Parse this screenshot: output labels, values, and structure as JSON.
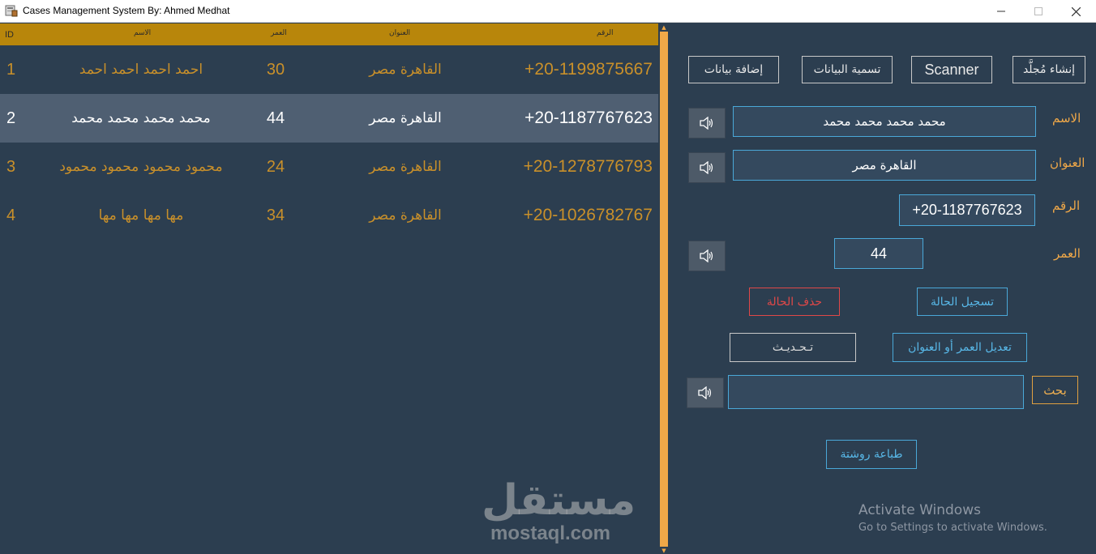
{
  "window": {
    "title": "Cases Management System By: Ahmed Medhat"
  },
  "table": {
    "columns": [
      "ID",
      "الاسم",
      "العمر",
      "العنوان",
      "الرقم"
    ],
    "rows": [
      {
        "id": "1",
        "name": "احمد احمد احمد احمد",
        "age": "30",
        "address": "القاهرة مصر",
        "phone": "+20-1199875667"
      },
      {
        "id": "2",
        "name": "محمد محمد محمد محمد",
        "age": "44",
        "address": "القاهرة مصر",
        "phone": "+20-1187767623"
      },
      {
        "id": "3",
        "name": "محمود محمود محمود محمود",
        "age": "24",
        "address": "القاهرة مصر",
        "phone": "+20-1278776793"
      },
      {
        "id": "4",
        "name": "مها مها مها مها",
        "age": "34",
        "address": "القاهرة مصر",
        "phone": "+20-1026782767"
      }
    ],
    "selected_row": 2
  },
  "toolbar": {
    "create_folder": "إنشاء مُجلَّد",
    "scanner": "Scanner",
    "name_data": "تسمية البيانات",
    "add_data": "إضافة بيانات"
  },
  "form": {
    "name_label": "الاسم",
    "name_value": "محمد محمد محمد محمد",
    "address_label": "العنوان",
    "address_value": "القاهرة مصر",
    "phone_label": "الرقم",
    "phone_value": "+20-1187767623",
    "age_label": "العمر",
    "age_value": "44"
  },
  "actions": {
    "register_case": "تسجيل الحالة",
    "delete_case": "حذف الحالة",
    "edit_age_address": "تعديل العمر أو العنوان",
    "refresh": "تـحـديـث",
    "search": "بحث",
    "search_value": "",
    "print_prescription": "طباعة روشتة"
  },
  "watermark": {
    "arabic": "مستقل",
    "latin": "mostaql.com"
  },
  "activation": {
    "line1": "Activate Windows",
    "line2": "Go to Settings to activate Windows."
  },
  "colors": {
    "background": "#2c3e50",
    "header": "#b8860b",
    "accent": "#f0a848",
    "selected_row": "#4f5f72",
    "blue_border": "#4aa8d8",
    "red": "#e04848"
  },
  "icons": [
    "app-icon",
    "minimize-icon",
    "maximize-icon",
    "close-icon",
    "speaker-icon"
  ]
}
